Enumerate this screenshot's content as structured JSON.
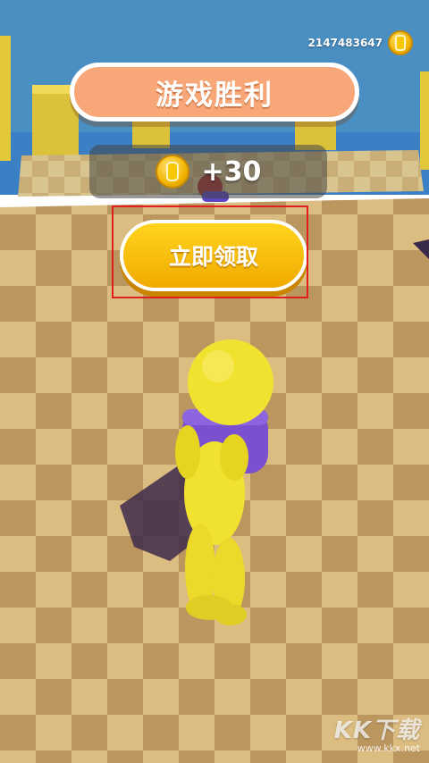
{
  "hud": {
    "coin_total": "2147483647",
    "coin_icon": "coin-icon"
  },
  "result": {
    "title": "游戏胜利",
    "reward_amount": "+30",
    "claim_label": "立即领取"
  },
  "watermark": {
    "logo": "KK下载",
    "url": "www.kkx.net"
  },
  "colors": {
    "sky": "#4a8fc2",
    "title_pill": "#f8a878",
    "claim_button": "#f7c200",
    "highlight": "#e02020",
    "player": "#f2e230",
    "prop": "#7a4fd0"
  }
}
